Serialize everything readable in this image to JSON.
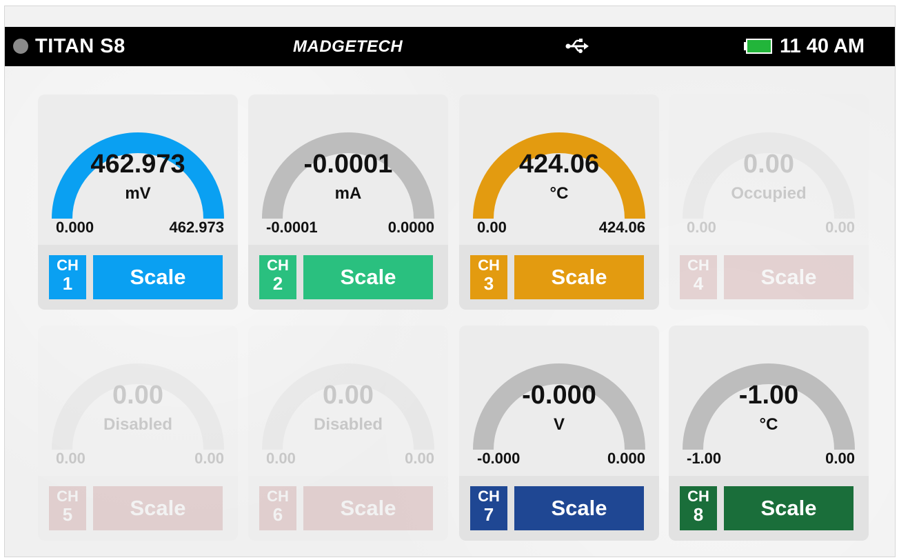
{
  "status": {
    "device_name": "TITAN S8",
    "brand": "MADGETECH",
    "time": "11 40 AM",
    "battery_color": "#22b53a"
  },
  "channels": [
    {
      "channel": "CH",
      "number": "1",
      "reading": "462.973",
      "unit": "mV",
      "min": "0.000",
      "max": "462.973",
      "button": "Scale",
      "color": "#0aa0f2",
      "arc_color": "#0aa0f2",
      "state": "active"
    },
    {
      "channel": "CH",
      "number": "2",
      "reading": "-0.0001",
      "unit": "mA",
      "min": "-0.0001",
      "max": "0.0000",
      "button": "Scale",
      "color": "#2ac07f",
      "arc_color": "#bdbdbd",
      "state": "active"
    },
    {
      "channel": "CH",
      "number": "3",
      "reading": "424.06",
      "unit": "°C",
      "min": "0.00",
      "max": "424.06",
      "button": "Scale",
      "color": "#e39b10",
      "arc_color": "#e39b10",
      "state": "active"
    },
    {
      "channel": "CH",
      "number": "4",
      "reading": "0.00",
      "unit": "Occupied",
      "min": "0.00",
      "max": "0.00",
      "button": "Scale",
      "color": "#9b3a3a",
      "arc_color": "#bdbdbd",
      "state": "occupied"
    },
    {
      "channel": "CH",
      "number": "5",
      "reading": "0.00",
      "unit": "Disabled",
      "min": "0.00",
      "max": "0.00",
      "button": "Scale",
      "color": "#9b3a3a",
      "arc_color": "#bdbdbd",
      "state": "disabled"
    },
    {
      "channel": "CH",
      "number": "6",
      "reading": "0.00",
      "unit": "Disabled",
      "min": "0.00",
      "max": "0.00",
      "button": "Scale",
      "color": "#9b3a3a",
      "arc_color": "#bdbdbd",
      "state": "disabled"
    },
    {
      "channel": "CH",
      "number": "7",
      "reading": "-0.000",
      "unit": "V",
      "min": "-0.000",
      "max": "0.000",
      "button": "Scale",
      "color": "#1f4793",
      "arc_color": "#bdbdbd",
      "state": "active"
    },
    {
      "channel": "CH",
      "number": "8",
      "reading": "-1.00",
      "unit": "°C",
      "min": "-1.00",
      "max": "0.00",
      "button": "Scale",
      "color": "#1a6e3a",
      "arc_color": "#bdbdbd",
      "state": "active"
    }
  ]
}
